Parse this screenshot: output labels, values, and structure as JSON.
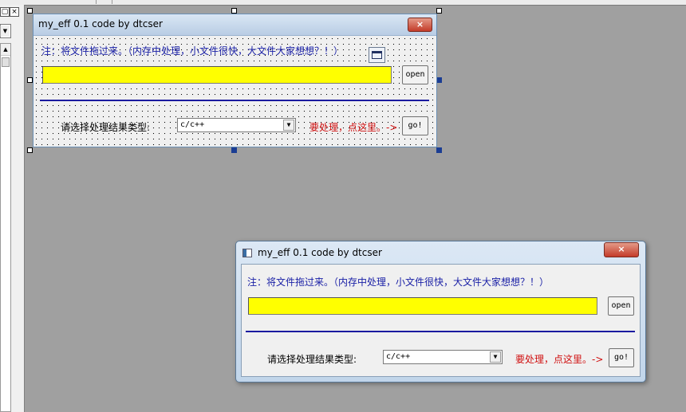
{
  "ide": {
    "left_buttons": [
      "▢",
      "×"
    ]
  },
  "design_form": {
    "title": "my_eff 0.1 code by dtcser",
    "close_label": "×",
    "note": "注：将文件拖过来。（内存中处理，小文件很快，大文件大家想想？！）",
    "file_path_value": "",
    "open_label": "open",
    "type_label": "请选择处理结果类型:",
    "type_selected": "c/c++",
    "hint": "要处理，点这里。->",
    "go_label": "go!"
  },
  "run_form": {
    "title": "my_eff 0.1 code by dtcser",
    "close_label": "×",
    "note": "注：将文件拖过来。（内存中处理，小文件很快，大文件大家想想？！）",
    "file_path_value": "",
    "open_label": "open",
    "type_label": "请选择处理结果类型:",
    "type_selected": "c/c++",
    "hint": "要处理，点这里。->",
    "go_label": "go!"
  },
  "colors": {
    "input_bg": "#ffff00",
    "note_text": "#1a20a6",
    "hint_text": "#d01010",
    "separator": "#1a1aa0"
  }
}
